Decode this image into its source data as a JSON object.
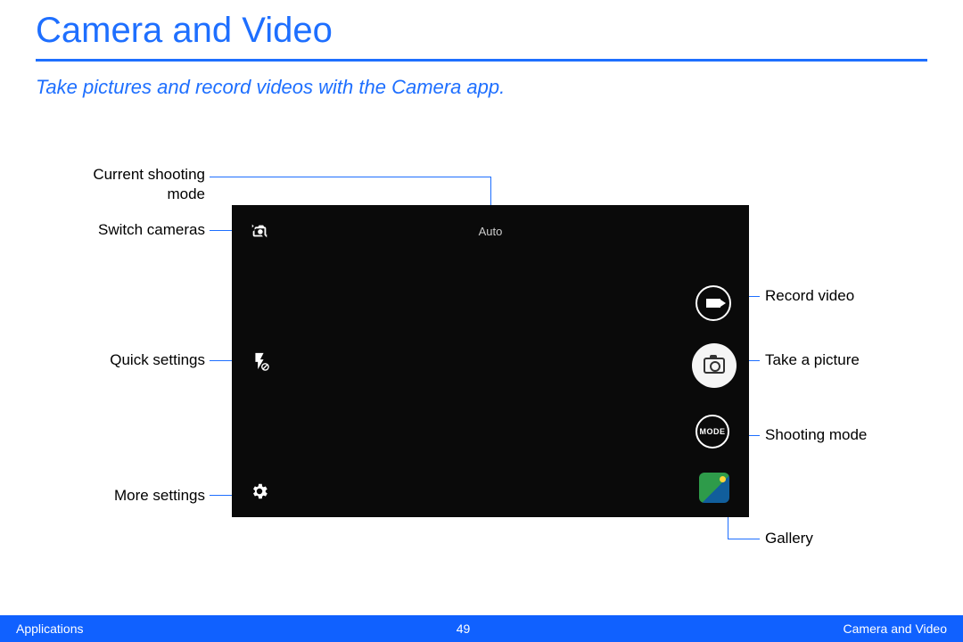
{
  "header": {
    "title": "Camera and Video",
    "subtitle": "Take pictures and record videos with the Camera app."
  },
  "callouts": {
    "current_shooting_mode_l1": "Current shooting",
    "current_shooting_mode_l2": "mode",
    "switch_cameras": "Switch cameras",
    "quick_settings": "Quick settings",
    "more_settings": "More settings",
    "record_video": "Record video",
    "take_picture": "Take a picture",
    "shooting_mode": "Shooting mode",
    "gallery": "Gallery"
  },
  "viewfinder": {
    "mode_label": "Auto",
    "mode_button_text": "MODE"
  },
  "footer": {
    "left": "Applications",
    "page": "49",
    "right": "Camera and Video"
  }
}
